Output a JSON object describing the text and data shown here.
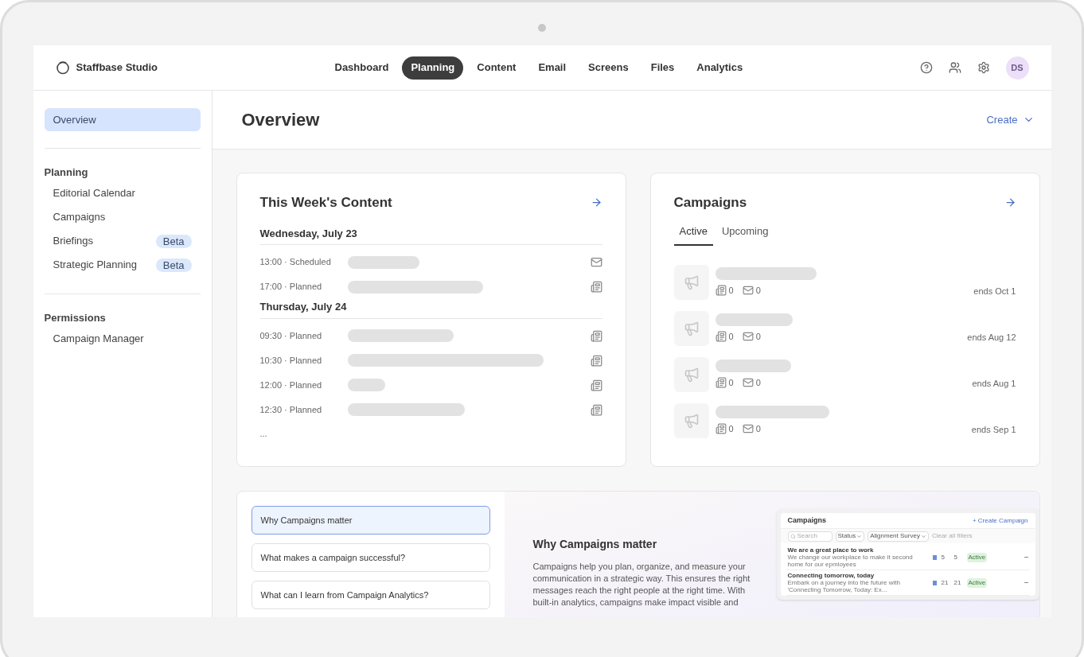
{
  "brand": {
    "name": "Staffbase Studio"
  },
  "nav": [
    {
      "label": "Dashboard",
      "selected": false
    },
    {
      "label": "Planning",
      "selected": true
    },
    {
      "label": "Content",
      "selected": false
    },
    {
      "label": "Email",
      "selected": false
    },
    {
      "label": "Screens",
      "selected": false
    },
    {
      "label": "Files",
      "selected": false
    },
    {
      "label": "Analytics",
      "selected": false
    }
  ],
  "user": {
    "initials": "DS"
  },
  "sidebar": {
    "top": {
      "label": "Overview",
      "selected": true
    },
    "sections": [
      {
        "title": "Planning",
        "items": [
          {
            "label": "Editorial Calendar",
            "selected": false
          },
          {
            "label": "Campaigns",
            "selected": false
          },
          {
            "label": "Briefings",
            "selected": false,
            "badge": "Beta"
          },
          {
            "label": "Strategic Planning",
            "selected": false,
            "badge": "Beta"
          }
        ]
      },
      {
        "title": "Permissions",
        "items": [
          {
            "label": "Campaign Manager",
            "selected": false
          }
        ]
      }
    ]
  },
  "page": {
    "title": "Overview",
    "create": "Create"
  },
  "week": {
    "title": "This Week's Content",
    "more": "...",
    "days": [
      {
        "date": "Wednesday, July 23",
        "items": [
          {
            "time": "13:00 · Scheduled",
            "kind": "email"
          },
          {
            "time": "17:00 · Planned",
            "kind": "article"
          }
        ]
      },
      {
        "date": "Thursday, July 24",
        "items": [
          {
            "time": "09:30 · Planned",
            "kind": "article"
          },
          {
            "time": "10:30 · Planned",
            "kind": "article"
          },
          {
            "time": "12:00 · Planned",
            "kind": "article"
          },
          {
            "time": "12:30 · Planned",
            "kind": "article"
          }
        ]
      }
    ]
  },
  "campaigns": {
    "title": "Campaigns",
    "tabs": [
      {
        "label": "Active",
        "selected": true
      },
      {
        "label": "Upcoming",
        "selected": false
      }
    ],
    "rows": [
      {
        "articles": "0",
        "emails": "0",
        "ends": "ends Oct 1"
      },
      {
        "articles": "0",
        "emails": "0",
        "ends": "ends Aug 12"
      },
      {
        "articles": "0",
        "emails": "0",
        "ends": "ends Aug 1"
      },
      {
        "articles": "0",
        "emails": "0",
        "ends": "ends Sep 1"
      }
    ]
  },
  "learn": {
    "questions": [
      {
        "label": "Why Campaigns matter",
        "selected": true
      },
      {
        "label": "What makes a campaign successful?",
        "selected": false
      },
      {
        "label": "What can I learn from Campaign Analytics?",
        "selected": false
      }
    ],
    "heading": "Why Campaigns matter",
    "text": "Campaigns help you plan, organize, and measure your communication in a strategic way. This ensures the right messages reach the right people at the right time. With built-in analytics, campaigns make impact visible and",
    "preview": {
      "title": "Campaigns",
      "create": "+ Create Campaign",
      "search": "Search",
      "filters": [
        "Status",
        "Alignment Survey"
      ],
      "clear": "Clear all filters",
      "rows": [
        {
          "name": "We are a great place to work",
          "desc": "We change our workplace to make it second home for our epmloyees",
          "emails": "5",
          "articles": "5",
          "status": "Active"
        },
        {
          "name": "Connecting tomorrow, today",
          "desc": "Embark on a journey into the future with 'Connecting Tomorrow, Today: Ex...",
          "emails": "21",
          "articles": "21",
          "status": "Active"
        }
      ]
    }
  }
}
